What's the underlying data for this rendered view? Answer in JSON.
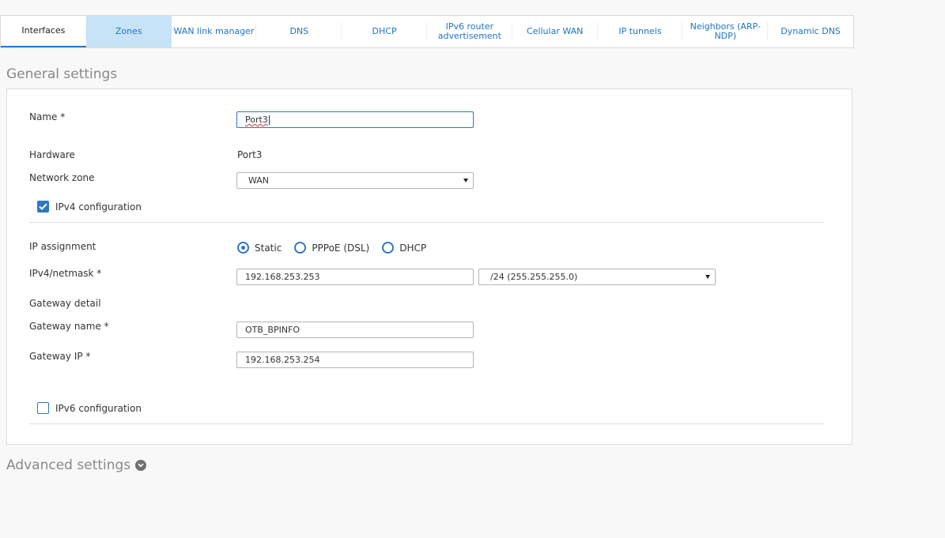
{
  "tabs": [
    {
      "label": "Interfaces",
      "state": "active"
    },
    {
      "label": "Zones",
      "state": "hovered"
    },
    {
      "label": "WAN link manager",
      "state": ""
    },
    {
      "label": "DNS",
      "state": ""
    },
    {
      "label": "DHCP",
      "state": ""
    },
    {
      "label": "IPv6 router advertisement",
      "state": ""
    },
    {
      "label": "Cellular WAN",
      "state": ""
    },
    {
      "label": "IP tunnels",
      "state": ""
    },
    {
      "label": "Neighbors (ARP-NDP)",
      "state": ""
    },
    {
      "label": "Dynamic DNS",
      "state": ""
    }
  ],
  "general": {
    "title": "General settings",
    "name_label": "Name *",
    "name_value": "Port3",
    "hardware_label": "Hardware",
    "hardware_value": "Port3",
    "zone_label": "Network zone",
    "zone_value": "WAN",
    "ipv4_config_label": "IPv4 configuration",
    "ipv4_config_checked": true,
    "ip_assignment_label": "IP assignment",
    "ip_assignment_options": [
      "Static",
      "PPPoE (DSL)",
      "DHCP"
    ],
    "ip_assignment_selected": "Static",
    "ipv4_netmask_label": "IPv4/netmask *",
    "ipv4_value": "192.168.253.253",
    "netmask_value": "/24 (255.255.255.0)",
    "gateway_detail_label": "Gateway detail",
    "gateway_name_label": "Gateway name *",
    "gateway_name_value": "OTB_BPINFO",
    "gateway_ip_label": "Gateway IP *",
    "gateway_ip_value": "192.168.253.254",
    "ipv6_config_label": "IPv6 configuration",
    "ipv6_config_checked": false
  },
  "advanced": {
    "title": "Advanced settings",
    "expand_icon": "chevron-down-circle-icon"
  },
  "colors": {
    "accent": "#2e77c7",
    "tab_link": "#1f74c2",
    "tab_hover_bg": "#c7e3f7",
    "heading_gray": "#888888"
  }
}
